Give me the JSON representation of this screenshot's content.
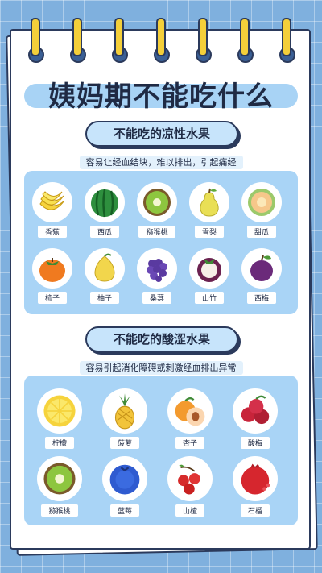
{
  "title": "姨妈期不能吃什么",
  "section1": {
    "title": "不能吃的凉性水果",
    "subtitle": "容易让经血结块，难以排出，引起痛经",
    "fruits": [
      "香蕉",
      "西瓜",
      "猕猴桃",
      "雪梨",
      "甜瓜",
      "柿子",
      "柚子",
      "桑葚",
      "山竹",
      "西梅"
    ]
  },
  "section2": {
    "title": "不能吃的酸涩水果",
    "subtitle": "容易引起消化障碍或刺激经血排出异常",
    "fruits": [
      "柠檬",
      "菠萝",
      "杏子",
      "酸梅",
      "猕猴桃",
      "蓝莓",
      "山楂",
      "石榴"
    ]
  },
  "colors": {
    "background": "#7fb0de",
    "panel": "#a9d4f6",
    "ring": "#f4cf3a",
    "outline": "#2b3a5c"
  }
}
